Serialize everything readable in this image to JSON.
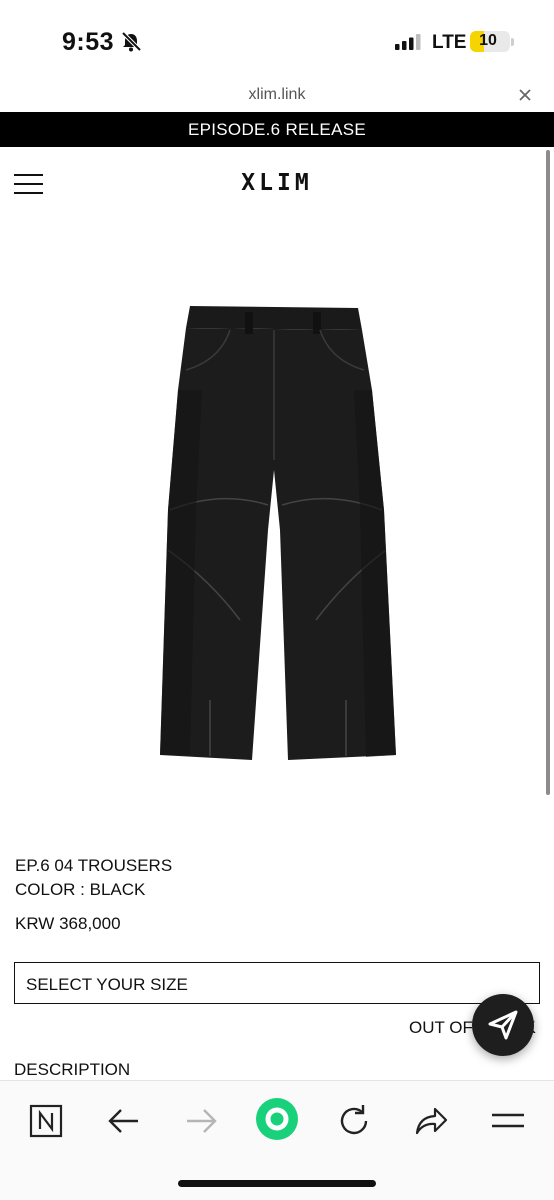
{
  "status_bar": {
    "time": "9:53",
    "network": "LTE",
    "battery": "10",
    "icons": [
      "bell-slash-icon",
      "signal-icon",
      "battery-icon"
    ]
  },
  "browser": {
    "url": "xlim.link",
    "close_icon": "close-icon"
  },
  "banner": {
    "text": "EPISODE.6 RELEASE"
  },
  "header": {
    "brand": "XLIM",
    "menu_icon": "hamburger-menu-icon"
  },
  "product": {
    "name": "EP.6 04 TROUSERS",
    "color": "COLOR : BLACK",
    "price": "KRW 368,000",
    "size_select_label": "SELECT YOUR SIZE",
    "stock_status": "OUT OF STOCK",
    "description_label": "DESCRIPTION"
  },
  "toolbar": {
    "items": [
      "naver-icon",
      "back-arrow-icon",
      "forward-arrow-icon",
      "home-circle-icon",
      "refresh-icon",
      "share-icon",
      "menu-icon"
    ],
    "accent_color": "#19d17a"
  }
}
